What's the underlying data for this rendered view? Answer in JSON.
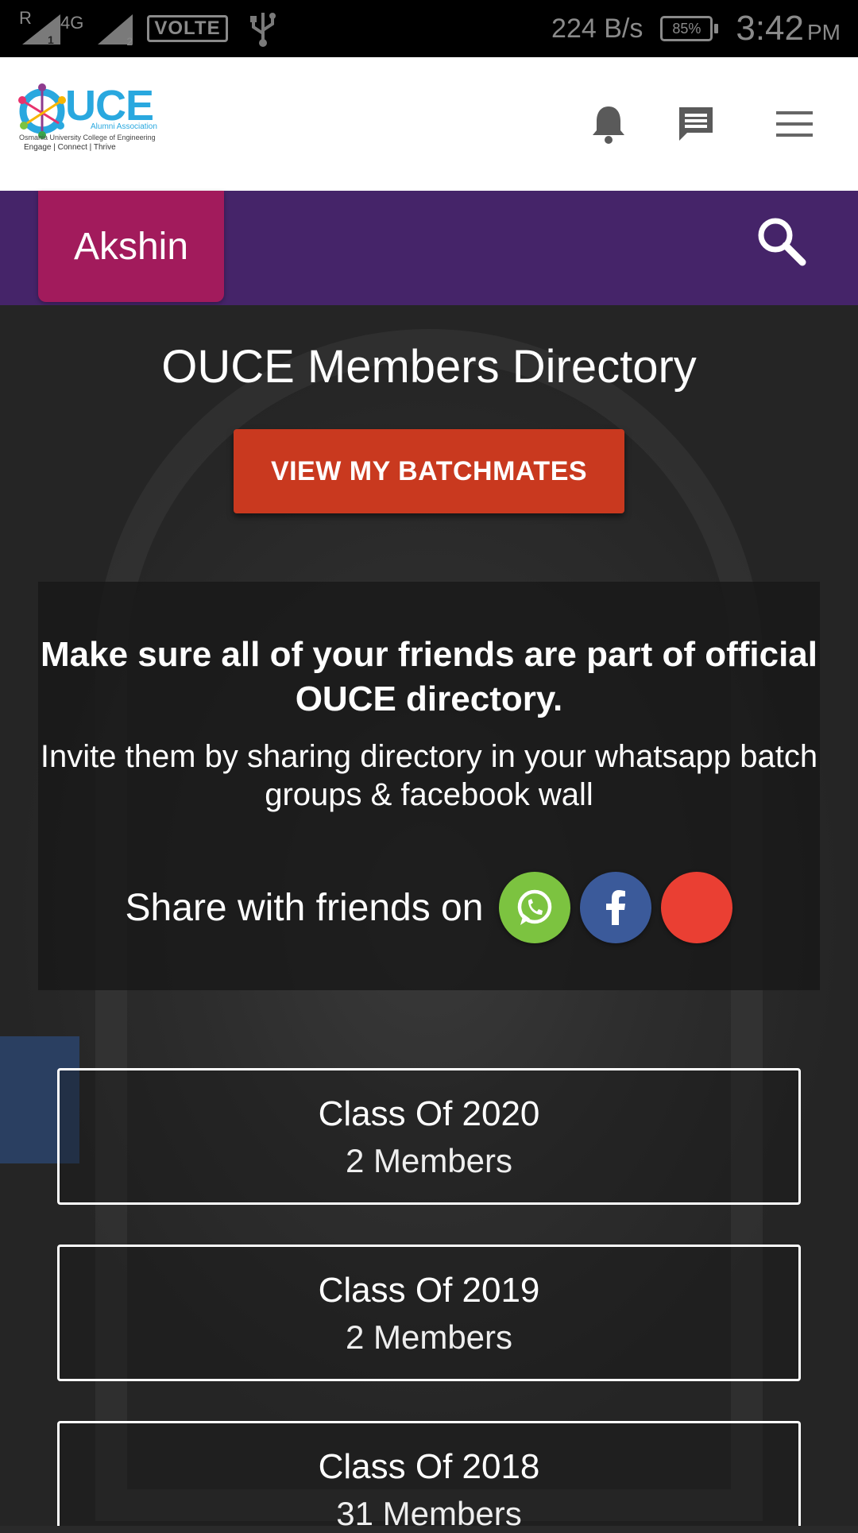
{
  "status_bar": {
    "carrier_r": "R",
    "network": "4G",
    "sim1": "1",
    "sim2": "2",
    "volte": "VOLTE",
    "speed": "224 B/s",
    "battery": "85%",
    "time": "3:42",
    "ampm": "PM"
  },
  "header": {
    "logo": {
      "title": "UCE",
      "line1": "Alumni Association",
      "line2": "Osmania University College of Engineering",
      "line3": "Engage   |   Connect   |   Thrive"
    },
    "icons": [
      "bell-icon",
      "chat-icon",
      "menu-icon"
    ]
  },
  "user_bar": {
    "name": "Akshin",
    "search_icon": "search-icon"
  },
  "main": {
    "title": "OUCE Members Directory",
    "batchmates_button": "VIEW MY BATCHMATES",
    "invite": {
      "heading": "Make sure all of your friends are part of official OUCE directory.",
      "body": "Invite them by sharing directory in your whatsapp batch groups & facebook wall",
      "share_label": "Share with friends on"
    },
    "share_buttons": [
      {
        "name": "whatsapp",
        "color": "#7cc340"
      },
      {
        "name": "facebook",
        "color": "#3b5a9a"
      },
      {
        "name": "other",
        "color": "#ea3f33"
      }
    ],
    "classes": [
      {
        "title": "Class Of 2020",
        "members": "2 Members"
      },
      {
        "title": "Class Of 2019",
        "members": "2 Members"
      },
      {
        "title": "Class Of 2018",
        "members": "31 Members"
      }
    ]
  },
  "colors": {
    "purple_bar": "#452469",
    "user_chip": "#a21b5c",
    "primary_button": "#c9391f",
    "logo_blue": "#29a8df"
  }
}
